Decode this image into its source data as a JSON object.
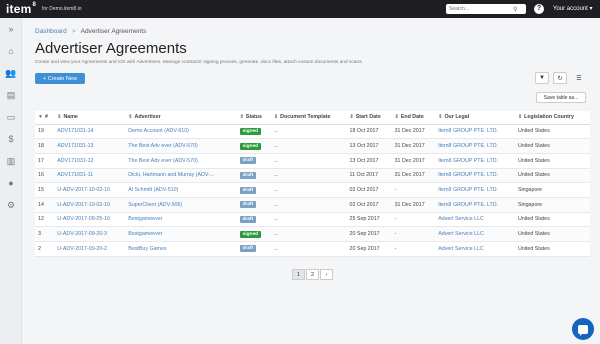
{
  "topbar": {
    "logo": "item",
    "logo_sup": "8",
    "for_org": "for Demo.item8.io",
    "search_placeholder": "Search...",
    "search_icon": "search-icon",
    "help_label": "?",
    "account_label": "Your account ▾"
  },
  "sidebar": {
    "items": [
      {
        "icon": "expand-icon",
        "glyph": "»"
      },
      {
        "icon": "home-icon",
        "glyph": "⌂"
      },
      {
        "icon": "users-icon",
        "glyph": "👥"
      },
      {
        "icon": "document-icon",
        "glyph": "▤"
      },
      {
        "icon": "money-icon",
        "glyph": "▭"
      },
      {
        "icon": "dollar-icon",
        "glyph": "$"
      },
      {
        "icon": "chart-icon",
        "glyph": "▥"
      },
      {
        "icon": "person-icon",
        "glyph": "●"
      },
      {
        "icon": "settings-icon",
        "glyph": "⚙"
      }
    ]
  },
  "breadcrumb": {
    "home": "Dashboard",
    "sep": ">",
    "current": "Advertiser Agreements"
  },
  "page": {
    "title": "Advertiser Agreements",
    "subtitle": "Create and view your Agreements and IOs with Advertisers. Manage contracts' signing process, generate .docx files, attach custom documents and scans.",
    "create_label": "+ Create New",
    "filter_label": "▼",
    "refresh_label": "↻",
    "columns_label": "☰",
    "save_table_label": "Save table as..."
  },
  "table": {
    "headers": [
      "#",
      "Name",
      "Advertiser",
      "Status",
      "Document Template",
      "Start Date",
      "End Date",
      "Our Legal",
      "Legislation Country"
    ],
    "rows": [
      {
        "id": "19",
        "name": "ADV171031-14",
        "advertiser": "Demo Account (ADV-610)",
        "status": "signed",
        "template": "...",
        "start": "18 Oct 2017",
        "end": "31 Dec 2017",
        "legal": "Item8 GROUP PTE. LTD.",
        "country": "United States"
      },
      {
        "id": "18",
        "name": "ADV171031-13",
        "advertiser": "The Best Adv ever (ADV-570)",
        "status": "signed",
        "template": "...",
        "start": "13 Oct 2017",
        "end": "31 Dec 2017",
        "legal": "Item8 GROUP PTE. LTD.",
        "country": "United States"
      },
      {
        "id": "17",
        "name": "ADV171031-12",
        "advertiser": "The Best Adv ever (ADV-570)",
        "status": "draft",
        "template": "...",
        "start": "13 Oct 2017",
        "end": "31 Dec 2017",
        "legal": "Item8 GROUP PTE. LTD.",
        "country": "United States"
      },
      {
        "id": "16",
        "name": "ADV171031-11",
        "advertiser": "Dicki, Hartmann and Murray (ADV-...",
        "status": "draft",
        "template": "...",
        "start": "11 Oct 2017",
        "end": "31 Dec 2017",
        "legal": "Item8 GROUP PTE. LTD.",
        "country": "United States"
      },
      {
        "id": "15",
        "name": "U-ADV-2017-10-02-10",
        "advertiser": "Al Schmitt (ADV-510)",
        "status": "draft",
        "template": "...",
        "start": "02 Oct 2017",
        "end": "-",
        "legal": "Item8 GROUP PTE. LTD.",
        "country": "Singapore"
      },
      {
        "id": "14",
        "name": "U-ADV-2017-10-02-10",
        "advertiser": "SuperClient (ADV-506)",
        "status": "draft",
        "template": "...",
        "start": "02 Oct 2017",
        "end": "31 Dec 2017",
        "legal": "Item8 GROUP PTE. LTD.",
        "country": "Singapore"
      },
      {
        "id": "12",
        "name": "U-ADV-2017-09-25-10",
        "advertiser": "Bestgameever",
        "status": "draft",
        "template": "...",
        "start": "25 Sep 2017",
        "end": "-",
        "legal": "Advert Service LLC",
        "country": "United States"
      },
      {
        "id": "3",
        "name": "U-ADV-2017-09-20-3",
        "advertiser": "Bestgameever",
        "status": "signed",
        "template": "...",
        "start": "20 Sep 2017",
        "end": "-",
        "legal": "Advert Service LLC",
        "country": "United States"
      },
      {
        "id": "2",
        "name": "U-ADV-2017-09-20-2",
        "advertiser": "BestBuy Games",
        "status": "draft",
        "template": "...",
        "start": "20 Sep 2017",
        "end": "-",
        "legal": "Advert Service LLC",
        "country": "United States"
      }
    ]
  },
  "status_colors": {
    "signed": "#2e9a3e",
    "draft": "#7aa0c4"
  },
  "pagination": {
    "pages": [
      "1",
      "2"
    ],
    "next": "›",
    "current": "1"
  }
}
